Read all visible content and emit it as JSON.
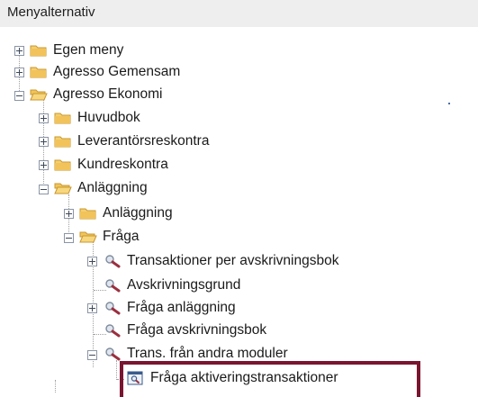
{
  "header": {
    "title": "Menyalternativ"
  },
  "tree": {
    "egen_meny": "Egen meny",
    "agresso_gemensam": "Agresso Gemensam",
    "agresso_ekonomi": "Agresso Ekonomi",
    "huvudbok": "Huvudbok",
    "leverantorsreskontra": "Leverantörsreskontra",
    "kundreskontra": "Kundreskontra",
    "anlaggning": "Anläggning",
    "anlaggning_sub": "Anläggning",
    "fraga": "Fråga",
    "transaktioner_per_avskrivningsbok": "Transaktioner per avskrivningsbok",
    "avskrivningsgrund": "Avskrivningsgrund",
    "fraga_anlaggning": "Fråga anläggning",
    "fraga_avskrivningsbok": "Fråga avskrivningsbok",
    "trans_fran_andra_moduler": "Trans. från andra moduler",
    "fraga_aktiveringstransaktioner": "Fråga aktiveringstransaktioner"
  },
  "colors": {
    "header_bg": "#eeeeee",
    "folder": "#e8b84a",
    "search_handle": "#9b2f3f",
    "highlight_border": "#7a1530"
  },
  "icons": [
    "folder-icon",
    "folder-open-icon",
    "search-query-icon",
    "screen-query-icon",
    "expand-plus-icon",
    "collapse-minus-icon"
  ]
}
